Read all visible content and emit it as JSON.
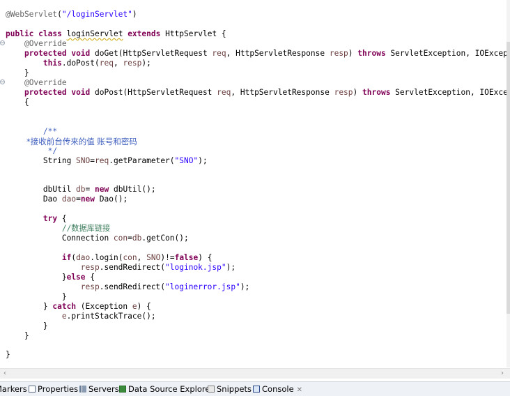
{
  "editor": {
    "annotation_webservlet": "@WebServlet",
    "paren_open": "(",
    "webservlet_path": "\"/loginServlet\"",
    "paren_close": ")",
    "kw_public": "public",
    "kw_class": "class",
    "kw_extends": "extends",
    "class_name": "loginServlet",
    "superclass": "HttpServlet {",
    "override1": "@Override",
    "kw_protected": "protected",
    "kw_void": "void",
    "kw_throws": "throws",
    "kw_this": "this",
    "doget_sig": "doGet(HttpServletRequest ",
    "param_req": "req",
    "comma_sep": ", ",
    "response_type": "HttpServletResponse ",
    "param_resp": "resp",
    "close_paren": ") ",
    "doget_exc": " ServletException, IOException {",
    "dopost_call": ".doPost(",
    "call_end": ");",
    "brace_close": "}",
    "override2": "@Override",
    "dopost_sig": "doPost(HttpServletRequest ",
    "dopost_exc": " ServletException, IOException",
    "brace_open": "{",
    "doc_start": "/**",
    "doc_star": "*",
    "doc_text": "接收前台传来的值 账号和密码",
    "doc_end": "*/",
    "sno_decl_a": "String ",
    "var_sno": "SNO",
    "sno_decl_b": "=",
    "sno_decl_c": ".getParameter(",
    "sno_key": "\"SNO\"",
    "dbutil_a": "dbUtil ",
    "var_db": "db",
    "eq_sp": "= ",
    "kw_new": "new",
    "dbutil_b": " dbUtil();",
    "dao_a": "Dao ",
    "var_dao": "dao",
    "eq": "=",
    "dao_b": " Dao();",
    "kw_try": "try",
    "try_brace": " {",
    "comment_conn": "//数据库链接",
    "conn_a": "Connection ",
    "var_con": "con",
    "conn_b": "=",
    "conn_c": ".getCon();",
    "kw_if": "if",
    "if_a": "(",
    "if_b": ".login(",
    "if_c": ", ",
    "if_d": ")!=",
    "kw_false": "false",
    "if_e": ") {",
    "redirect_a": ".sendRedirect(",
    "redirect_ok": "\"loginok.jsp\"",
    "else_a": "}",
    "kw_else": "else",
    "else_b": " {",
    "redirect_err": "\"loginerror.jsp\"",
    "catch_a": "} ",
    "kw_catch": "catch",
    "catch_b": " (Exception ",
    "var_e": "e",
    "catch_c": ") {",
    "print_b": ".printStackTrace();"
  },
  "panel_tabs": {
    "markers": "Markers",
    "properties": "Properties",
    "servers": "Servers",
    "data_source_explorer": "Data Source Explorer",
    "snippets": "Snippets",
    "console": "Console",
    "close_glyph": "✕"
  },
  "icons": {
    "fold": "fold-minus-icon",
    "properties": "properties-icon",
    "servers": "servers-icon",
    "data_source": "database-icon",
    "snippets": "snippets-icon",
    "console": "console-icon"
  },
  "colors": {
    "keyword": "#7f0055",
    "string": "#2a00ff",
    "comment": "#3f7f5f",
    "javadoc": "#3f5fbf",
    "local_variable": "#6a3e3e",
    "annotation": "#646464"
  }
}
